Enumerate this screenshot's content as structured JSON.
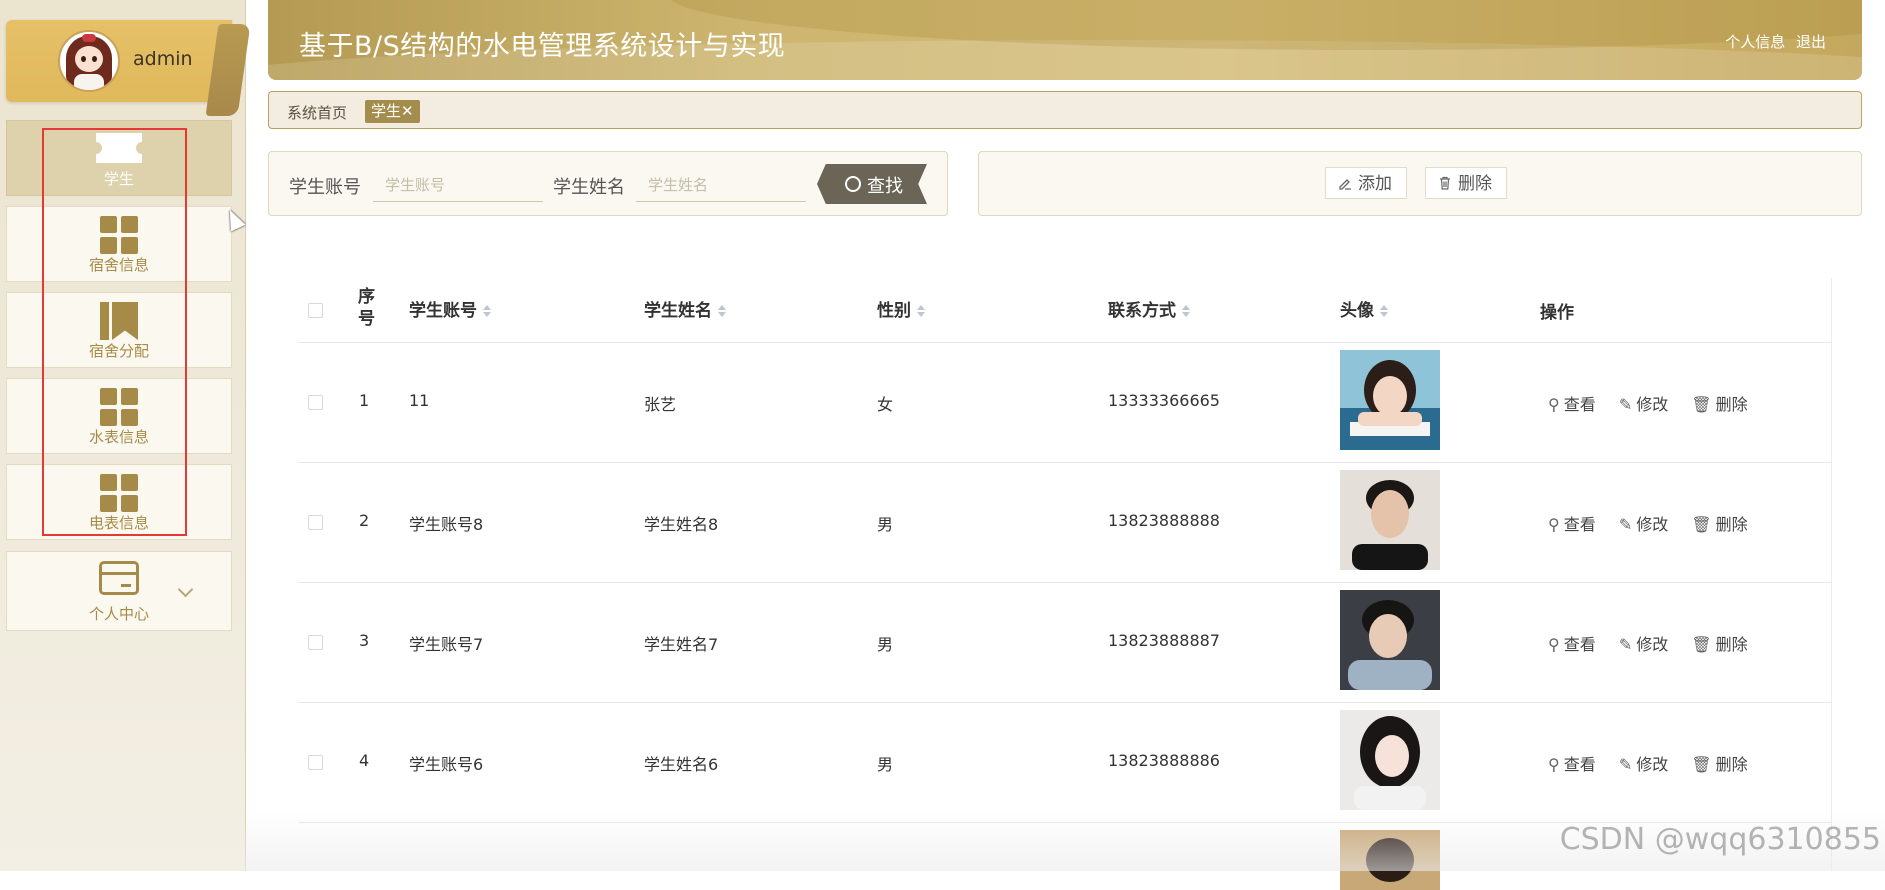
{
  "sidebar": {
    "username": "admin",
    "items": [
      {
        "label": "学生",
        "icon": "ticket-icon"
      },
      {
        "label": "宿舍信息",
        "icon": "grid-icon"
      },
      {
        "label": "宿舍分配",
        "icon": "book-icon"
      },
      {
        "label": "水表信息",
        "icon": "grid-icon"
      },
      {
        "label": "电表信息",
        "icon": "grid-icon"
      },
      {
        "label": "个人中心",
        "icon": "card-icon"
      }
    ]
  },
  "header": {
    "title": "基于B/S结构的水电管理系统设计与实现",
    "profile_link": "个人信息",
    "logout_link": "退出"
  },
  "breadcrumb": {
    "home": "系统首页",
    "tag": "学生✕"
  },
  "search": {
    "account_label": "学生账号",
    "account_placeholder": "学生账号",
    "name_label": "学生姓名",
    "name_placeholder": "学生姓名",
    "button": "查找"
  },
  "actions": {
    "add": "添加",
    "delete": "删除"
  },
  "table": {
    "headers": {
      "index_top": "序",
      "index_bottom": "号",
      "account": "学生账号",
      "name": "学生姓名",
      "gender": "性别",
      "phone": "联系方式",
      "avatar": "头像",
      "ops": "操作"
    },
    "row_actions": {
      "view": "查看",
      "edit": "修改",
      "delete": "删除"
    },
    "rows": [
      {
        "index": "1",
        "account": "11",
        "name": "张艺",
        "gender": "女",
        "phone": "13333366665"
      },
      {
        "index": "2",
        "account": "学生账号8",
        "name": "学生姓名8",
        "gender": "男",
        "phone": "13823888888"
      },
      {
        "index": "3",
        "account": "学生账号7",
        "name": "学生姓名7",
        "gender": "男",
        "phone": "13823888887"
      },
      {
        "index": "4",
        "account": "学生账号6",
        "name": "学生姓名6",
        "gender": "男",
        "phone": "13823888886"
      }
    ]
  },
  "watermark": "CSDN @wqq6310855",
  "colors": {
    "accent": "#a58b47",
    "header": "#c8ad66",
    "highlight": "#e53935"
  }
}
